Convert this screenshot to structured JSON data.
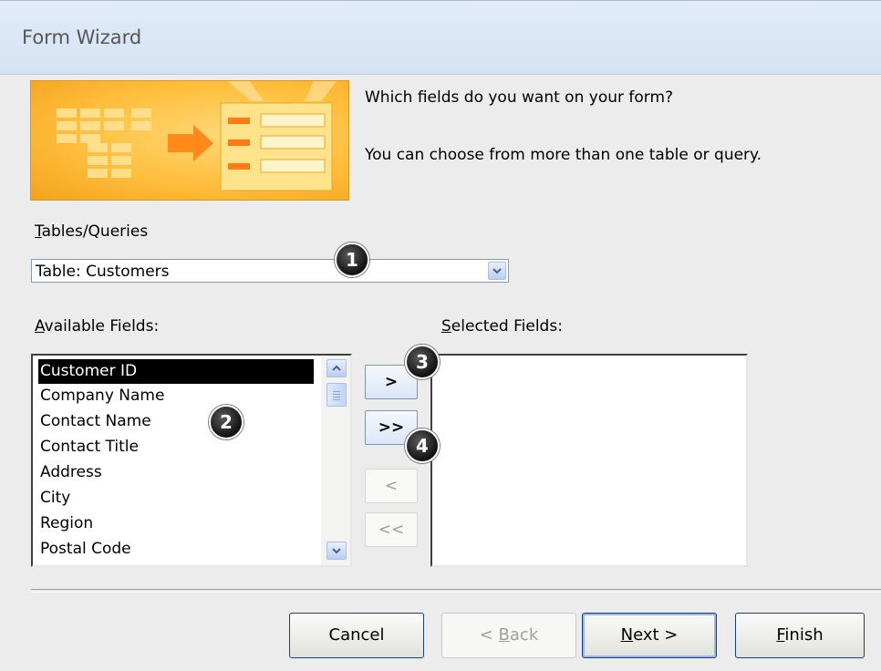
{
  "window": {
    "title": "Form Wizard"
  },
  "prompt": {
    "question": "Which fields do you want on your form?",
    "hint": "You can choose from more than one table or query."
  },
  "tables_queries": {
    "label_accel": "T",
    "label_rest": "ables/Queries",
    "value": "Table: Customers"
  },
  "available": {
    "label_accel": "A",
    "label_rest": "vailable Fields:",
    "items": [
      "Customer ID",
      "Company Name",
      "Contact Name",
      "Contact Title",
      "Address",
      "City",
      "Region",
      "Postal Code"
    ],
    "selected_index": 0
  },
  "selected": {
    "label_accel": "S",
    "label_rest": "elected Fields:",
    "items": []
  },
  "move_buttons": {
    "add": ">",
    "add_all": ">>",
    "remove": "<",
    "remove_all": "<<"
  },
  "callouts": [
    "1",
    "2",
    "3",
    "4"
  ],
  "footer": {
    "cancel": "Cancel",
    "back_pre": "< ",
    "back_accel": "B",
    "back_rest": "ack",
    "next_accel": "N",
    "next_rest": "ext >",
    "finish_accel": "F",
    "finish_rest": "inish"
  }
}
